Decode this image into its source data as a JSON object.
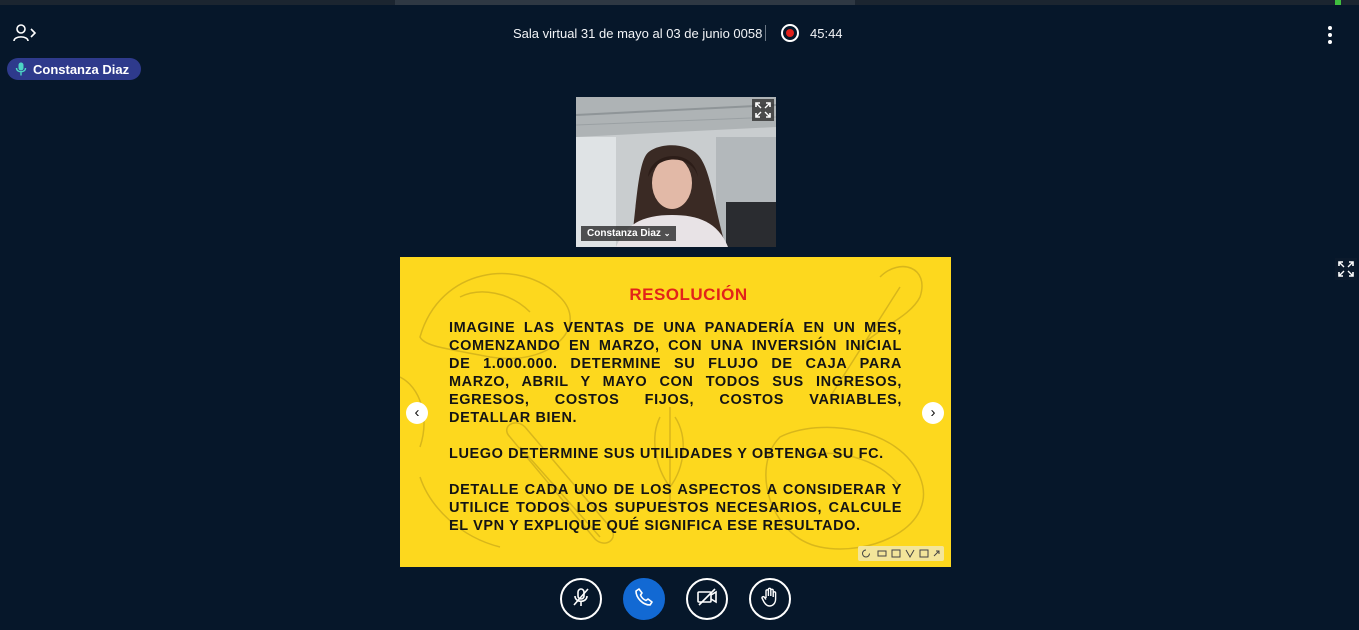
{
  "header": {
    "meeting_title": "Sala virtual 31 de mayo al 03 de junio 0058",
    "recording_time": "45:44",
    "recording_color": "#e0201b"
  },
  "talking_indicator": {
    "name": "Constanza Diaz",
    "icon": "microphone-icon",
    "color": "#2e3a8c"
  },
  "webcam": {
    "user_name": "Constanza Diaz"
  },
  "presentation": {
    "background_color": "#fdd81e",
    "title": "RESOLUCIÓN",
    "paragraphs": [
      "IMAGINE LAS VENTAS DE UNA PANADERÍA EN UN MES, COMENZANDO EN MARZO, CON UNA INVERSIÓN INICIAL DE 1.000.000. DETERMINE SU FLUJO DE CAJA PARA MARZO, ABRIL Y MAYO CON TODOS SUS INGRESOS, EGRESOS, COSTOS FIJOS, COSTOS VARIABLES, DETALLAR BIEN.",
      "LUEGO DETERMINE SUS UTILIDADES Y OBTENGA SU FC.",
      "DETALLE CADA UNO DE LOS ASPECTOS A CONSIDERAR Y UTILICE TODOS LOS SUPUESTOS NECESARIOS, CALCULE EL VPN Y EXPLIQUE QUÉ SIGNIFICA ESE RESULTADO."
    ],
    "prev_glyph": "‹",
    "next_glyph": "›"
  },
  "actions": {
    "primary_color": "#1269d3",
    "icons": [
      "mic-muted-icon",
      "phone-icon",
      "camera-off-icon",
      "raise-hand-icon"
    ]
  }
}
